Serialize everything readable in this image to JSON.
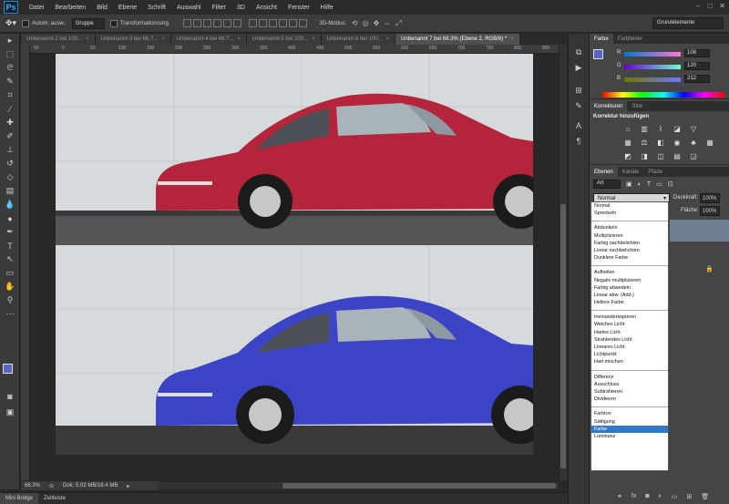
{
  "app": {
    "logo": "Ps"
  },
  "menu": [
    "Datei",
    "Bearbeiten",
    "Bild",
    "Ebene",
    "Schrift",
    "Auswahl",
    "Filter",
    "3D",
    "Ansicht",
    "Fenster",
    "Hilfe"
  ],
  "window_controls": [
    "–",
    "□",
    "✕"
  ],
  "options": {
    "auto_select": "Autom. ausw.:",
    "group_select": "Gruppe",
    "transform": "Transformationsstrg.",
    "mode_3d": "3D-Modus:",
    "workspace": "Grundelemente"
  },
  "tabs": [
    {
      "label": "Unbenannt-2 bei 100...",
      "active": false
    },
    {
      "label": "Unbenannt-3 bei 66.7...",
      "active": false
    },
    {
      "label": "Unbenannt-4 bei 66.7...",
      "active": false
    },
    {
      "label": "Unbenannt-5 bei 100...",
      "active": false
    },
    {
      "label": "Unbenannt-6 bei 100...",
      "active": false
    },
    {
      "label": "Unbenannt 7 bei 68.3% (Ebene 2, RGB/8) *",
      "active": true
    }
  ],
  "ruler_labels": [
    "50",
    "0",
    "50",
    "100",
    "150",
    "200",
    "250",
    "300",
    "350",
    "400",
    "450",
    "500",
    "550",
    "600",
    "650",
    "700",
    "750",
    "800",
    "850"
  ],
  "status": {
    "zoom": "68.3%",
    "doc": "Dok: 5.02 MB/18.4 MB"
  },
  "bottom_tabs": [
    {
      "label": "Mini Bridge",
      "active": true
    },
    {
      "label": "Zeitleiste",
      "active": false
    }
  ],
  "color_panel": {
    "tabs": [
      "Farbe",
      "Farbfelder"
    ],
    "r_label": "R",
    "r_value": "108",
    "g_label": "G",
    "g_value": "120",
    "b_label": "B",
    "b_value": "212",
    "foreground": "#5a63c8"
  },
  "adjustments": {
    "tabs": [
      "Korrekturen",
      "Stile"
    ],
    "title": "Korrektur hinzufügen",
    "icons": [
      "brightness-icon",
      "levels-icon",
      "curves-icon",
      "exposure-icon",
      "vibrance-icon",
      "hue-icon",
      "balance-icon",
      "bw-icon",
      "photo-filter-icon",
      "channel-mixer-icon",
      "color-lookup-icon",
      "invert-icon",
      "posterize-icon",
      "threshold-icon",
      "gradient-map-icon",
      "selective-color-icon"
    ]
  },
  "layers": {
    "tabs": [
      "Ebenen",
      "Kanäle",
      "Pfade"
    ],
    "kind": "Art",
    "blend_mode": "Normal",
    "opacity_label": "Deckkraft:",
    "opacity_value": "100%",
    "fill_label": "Fläche:",
    "fill_value": "100%"
  },
  "blend_modes": {
    "groups": [
      [
        "Normal",
        "Sprenkeln"
      ],
      [
        "Abdunkeln",
        "Multiplizieren",
        "Farbig nachbelichten",
        "Linear nachbelichten",
        "Dunklere Farbe"
      ],
      [
        "Aufhellen",
        "Negativ multiplizieren",
        "Farbig abwedeln",
        "Linear abw. (Add.)",
        "Hellere Farbe"
      ],
      [
        "Ineinanderkopieren",
        "Weiches Licht",
        "Hartes Licht",
        "Strahlendes Licht",
        "Lineares Licht",
        "Lichtpunkt",
        "Hart mischen"
      ],
      [
        "Differenz",
        "Ausschluss",
        "Subtrahieren",
        "Dividieren"
      ],
      [
        "Farbton",
        "Sättigung",
        "Farbe",
        "Luminanz"
      ]
    ],
    "selected": "Farbe"
  },
  "photo_colors": {
    "top_car": "#b4243a",
    "bottom_car": "#3b44c4"
  }
}
